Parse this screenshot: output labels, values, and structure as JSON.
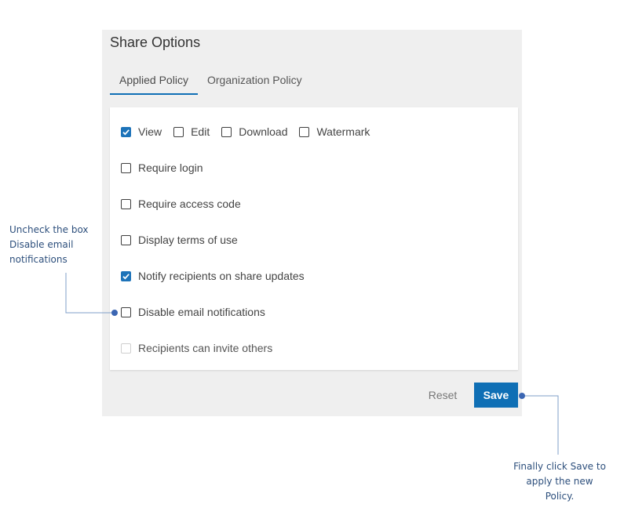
{
  "panel": {
    "title": "Share Options",
    "tabs": [
      {
        "label": "Applied Policy",
        "active": true
      },
      {
        "label": "Organization Policy",
        "active": false
      }
    ]
  },
  "options": {
    "permissions": [
      {
        "label": "View",
        "checked": true
      },
      {
        "label": "Edit",
        "checked": false
      },
      {
        "label": "Download",
        "checked": false
      },
      {
        "label": "Watermark",
        "checked": false
      }
    ],
    "require_login": {
      "label": "Require login",
      "checked": false
    },
    "require_access_code": {
      "label": "Require access code",
      "checked": false
    },
    "display_terms": {
      "label": "Display terms of use",
      "checked": false
    },
    "notify_recipients": {
      "label": "Notify recipients on share updates",
      "checked": true
    },
    "disable_email": {
      "label": "Disable email notifications",
      "checked": false
    },
    "recipients_invite": {
      "label": "Recipients can invite others",
      "checked": false,
      "disabled": true
    }
  },
  "footer": {
    "reset_label": "Reset",
    "save_label": "Save"
  },
  "callouts": {
    "left": [
      "Uncheck the box",
      "Disable email",
      "notifications"
    ],
    "right": [
      "Finally click Save to",
      "apply the new",
      "Policy."
    ]
  },
  "colors": {
    "accent": "#0f6fb5",
    "callout_line": "#7f9fc8",
    "callout_dot": "#3b66b3"
  }
}
